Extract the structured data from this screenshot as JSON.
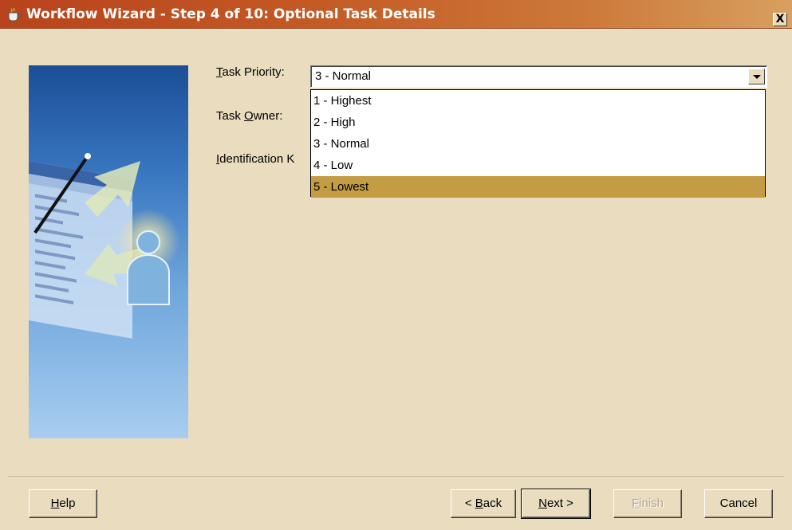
{
  "window": {
    "title": "Workflow Wizard - Step 4 of 10: Optional Task Details",
    "close_label": "X"
  },
  "form": {
    "task_priority": {
      "label": "Task Priority:",
      "mnemonic": "T",
      "rest": "ask Priority:",
      "value": "3 - Normal"
    },
    "task_owner": {
      "label": "Task Owner:",
      "prefix": "Task ",
      "mnemonic": "O",
      "rest": "wner:"
    },
    "identification": {
      "label": "Identification K",
      "mnemonic": "I",
      "rest": "dentification K"
    }
  },
  "dropdown": {
    "options": [
      "1 - Highest",
      "2 - High",
      "3 - Normal",
      "4 - Low",
      "5 - Lowest"
    ],
    "highlighted": "5 - Lowest"
  },
  "buttons": {
    "help": {
      "label": "Help",
      "mnemonic": "H",
      "rest": "elp"
    },
    "back": {
      "label": "< Back",
      "prefix": "< ",
      "mnemonic": "B",
      "rest": "ack"
    },
    "next": {
      "label": "Next >",
      "mnemonic": "N",
      "rest": "ext >"
    },
    "finish": {
      "label": "Finish",
      "mnemonic": "F",
      "rest": "inish",
      "enabled": false
    },
    "cancel": {
      "label": "Cancel"
    }
  },
  "colors": {
    "dialog_bg": "#e9dcbf",
    "titlebar_start": "#b8431c",
    "titlebar_end": "#d8a060",
    "highlight": "#c49c44"
  },
  "icons": {
    "app": "coffee-cup-icon",
    "close": "close-icon",
    "combo_arrow": "chevron-down-icon"
  }
}
